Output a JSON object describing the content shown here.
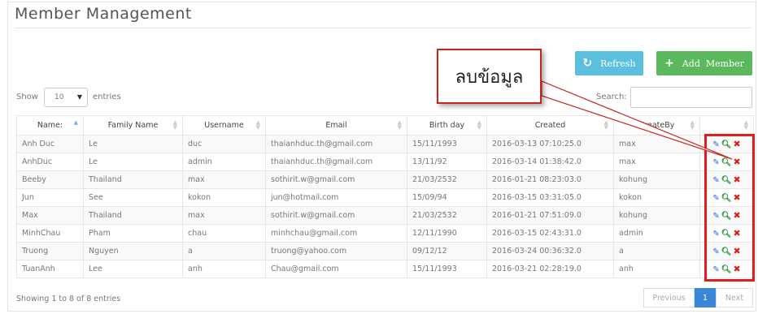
{
  "page": {
    "title": "Member Management"
  },
  "toolbar": {
    "refresh_label": "Refresh",
    "refresh_icon": "refresh-icon",
    "add_label": "Add  Member",
    "add_icon": "plus-icon",
    "refresh_color": "#5bc0de",
    "add_color": "#5cb85c"
  },
  "table_controls": {
    "show_label": "Show",
    "length_value": "10",
    "entries_label": "entries",
    "search_label": "Search:",
    "search_value": ""
  },
  "table": {
    "columns": [
      "Name:",
      "Family Name",
      "Username",
      "Email",
      "Birth day",
      "Created",
      "CreateBy",
      ""
    ],
    "rows": [
      [
        "Anh Duc",
        "Le",
        "duc",
        "thaianhduc.th@gmail.com",
        "15/11/1993",
        "2016-03-13 07:10:25.0",
        "max"
      ],
      [
        "AnhDuc",
        "Le",
        "admin",
        "thaianhduc.th@gmail.com",
        "13/11/92",
        "2016-03-14 01:38:42.0",
        "max"
      ],
      [
        "Beeby",
        "Thailand",
        "max",
        "sothirit.w@gmail.com",
        "21/03/2532",
        "2016-01-21 08:23:03.0",
        "kohung"
      ],
      [
        "Jun",
        "See",
        "kokon",
        "jun@hotmail.com",
        "15/09/94",
        "2016-03-15 03:31:05.0",
        "kokon"
      ],
      [
        "Max",
        "Thailand",
        "max",
        "sothirit.w@gmail.com",
        "21/03/2532",
        "2016-01-21 07:51:09.0",
        "kohung"
      ],
      [
        "MinhChau",
        "Pham",
        "chau",
        "minhchau@gmail.com",
        "12/11/1990",
        "2016-03-15 02:43:31.0",
        "admin"
      ],
      [
        "Truong",
        "Nguyen",
        "a",
        "truong@yahoo.com",
        "09/12/12",
        "2016-03-24 00:36:32.0",
        "a"
      ],
      [
        "TuanAnh",
        "Lee",
        "anh",
        "Chau@gmail.com",
        "15/11/1993",
        "2016-03-21 02:28:19.0",
        "anh"
      ]
    ],
    "action_icons": {
      "edit": "edit-icon",
      "view": "magnifier-icon",
      "delete": "delete-x-icon"
    }
  },
  "footer": {
    "showing_text": "Showing 1 to 8 of 8 entries",
    "previous_label": "Previous",
    "current_page": "1",
    "next_label": "Next"
  },
  "annotation": {
    "callout_text": "ลบข้อมูล",
    "highlight_color": "#e11d1d"
  }
}
